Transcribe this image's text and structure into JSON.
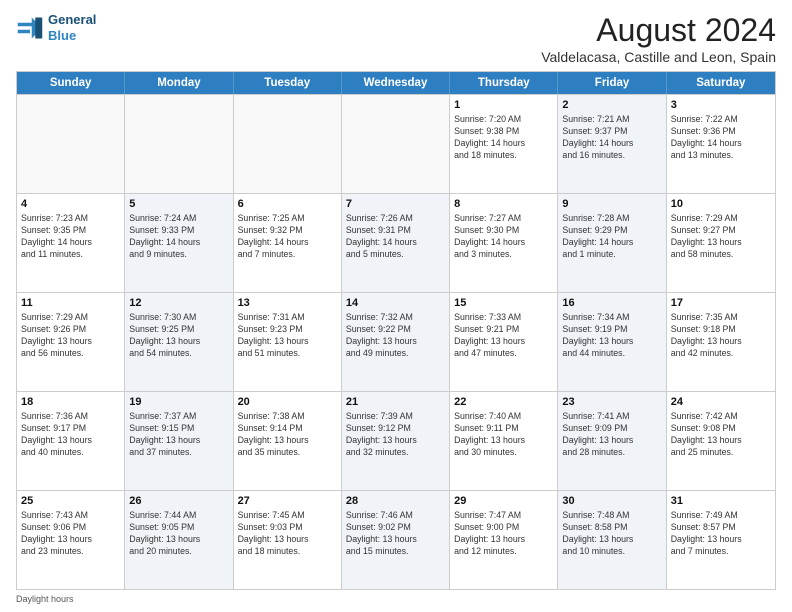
{
  "logo": {
    "line1": "General",
    "line2": "Blue"
  },
  "title": "August 2024",
  "subtitle": "Valdelacasa, Castille and Leon, Spain",
  "header_days": [
    "Sunday",
    "Monday",
    "Tuesday",
    "Wednesday",
    "Thursday",
    "Friday",
    "Saturday"
  ],
  "weeks": [
    [
      {
        "day": "",
        "info": "",
        "shaded": false,
        "empty": true
      },
      {
        "day": "",
        "info": "",
        "shaded": false,
        "empty": true
      },
      {
        "day": "",
        "info": "",
        "shaded": false,
        "empty": true
      },
      {
        "day": "",
        "info": "",
        "shaded": false,
        "empty": true
      },
      {
        "day": "1",
        "info": "Sunrise: 7:20 AM\nSunset: 9:38 PM\nDaylight: 14 hours\nand 18 minutes.",
        "shaded": false,
        "empty": false
      },
      {
        "day": "2",
        "info": "Sunrise: 7:21 AM\nSunset: 9:37 PM\nDaylight: 14 hours\nand 16 minutes.",
        "shaded": true,
        "empty": false
      },
      {
        "day": "3",
        "info": "Sunrise: 7:22 AM\nSunset: 9:36 PM\nDaylight: 14 hours\nand 13 minutes.",
        "shaded": false,
        "empty": false
      }
    ],
    [
      {
        "day": "4",
        "info": "Sunrise: 7:23 AM\nSunset: 9:35 PM\nDaylight: 14 hours\nand 11 minutes.",
        "shaded": false,
        "empty": false
      },
      {
        "day": "5",
        "info": "Sunrise: 7:24 AM\nSunset: 9:33 PM\nDaylight: 14 hours\nand 9 minutes.",
        "shaded": true,
        "empty": false
      },
      {
        "day": "6",
        "info": "Sunrise: 7:25 AM\nSunset: 9:32 PM\nDaylight: 14 hours\nand 7 minutes.",
        "shaded": false,
        "empty": false
      },
      {
        "day": "7",
        "info": "Sunrise: 7:26 AM\nSunset: 9:31 PM\nDaylight: 14 hours\nand 5 minutes.",
        "shaded": true,
        "empty": false
      },
      {
        "day": "8",
        "info": "Sunrise: 7:27 AM\nSunset: 9:30 PM\nDaylight: 14 hours\nand 3 minutes.",
        "shaded": false,
        "empty": false
      },
      {
        "day": "9",
        "info": "Sunrise: 7:28 AM\nSunset: 9:29 PM\nDaylight: 14 hours\nand 1 minute.",
        "shaded": true,
        "empty": false
      },
      {
        "day": "10",
        "info": "Sunrise: 7:29 AM\nSunset: 9:27 PM\nDaylight: 13 hours\nand 58 minutes.",
        "shaded": false,
        "empty": false
      }
    ],
    [
      {
        "day": "11",
        "info": "Sunrise: 7:29 AM\nSunset: 9:26 PM\nDaylight: 13 hours\nand 56 minutes.",
        "shaded": false,
        "empty": false
      },
      {
        "day": "12",
        "info": "Sunrise: 7:30 AM\nSunset: 9:25 PM\nDaylight: 13 hours\nand 54 minutes.",
        "shaded": true,
        "empty": false
      },
      {
        "day": "13",
        "info": "Sunrise: 7:31 AM\nSunset: 9:23 PM\nDaylight: 13 hours\nand 51 minutes.",
        "shaded": false,
        "empty": false
      },
      {
        "day": "14",
        "info": "Sunrise: 7:32 AM\nSunset: 9:22 PM\nDaylight: 13 hours\nand 49 minutes.",
        "shaded": true,
        "empty": false
      },
      {
        "day": "15",
        "info": "Sunrise: 7:33 AM\nSunset: 9:21 PM\nDaylight: 13 hours\nand 47 minutes.",
        "shaded": false,
        "empty": false
      },
      {
        "day": "16",
        "info": "Sunrise: 7:34 AM\nSunset: 9:19 PM\nDaylight: 13 hours\nand 44 minutes.",
        "shaded": true,
        "empty": false
      },
      {
        "day": "17",
        "info": "Sunrise: 7:35 AM\nSunset: 9:18 PM\nDaylight: 13 hours\nand 42 minutes.",
        "shaded": false,
        "empty": false
      }
    ],
    [
      {
        "day": "18",
        "info": "Sunrise: 7:36 AM\nSunset: 9:17 PM\nDaylight: 13 hours\nand 40 minutes.",
        "shaded": false,
        "empty": false
      },
      {
        "day": "19",
        "info": "Sunrise: 7:37 AM\nSunset: 9:15 PM\nDaylight: 13 hours\nand 37 minutes.",
        "shaded": true,
        "empty": false
      },
      {
        "day": "20",
        "info": "Sunrise: 7:38 AM\nSunset: 9:14 PM\nDaylight: 13 hours\nand 35 minutes.",
        "shaded": false,
        "empty": false
      },
      {
        "day": "21",
        "info": "Sunrise: 7:39 AM\nSunset: 9:12 PM\nDaylight: 13 hours\nand 32 minutes.",
        "shaded": true,
        "empty": false
      },
      {
        "day": "22",
        "info": "Sunrise: 7:40 AM\nSunset: 9:11 PM\nDaylight: 13 hours\nand 30 minutes.",
        "shaded": false,
        "empty": false
      },
      {
        "day": "23",
        "info": "Sunrise: 7:41 AM\nSunset: 9:09 PM\nDaylight: 13 hours\nand 28 minutes.",
        "shaded": true,
        "empty": false
      },
      {
        "day": "24",
        "info": "Sunrise: 7:42 AM\nSunset: 9:08 PM\nDaylight: 13 hours\nand 25 minutes.",
        "shaded": false,
        "empty": false
      }
    ],
    [
      {
        "day": "25",
        "info": "Sunrise: 7:43 AM\nSunset: 9:06 PM\nDaylight: 13 hours\nand 23 minutes.",
        "shaded": false,
        "empty": false
      },
      {
        "day": "26",
        "info": "Sunrise: 7:44 AM\nSunset: 9:05 PM\nDaylight: 13 hours\nand 20 minutes.",
        "shaded": true,
        "empty": false
      },
      {
        "day": "27",
        "info": "Sunrise: 7:45 AM\nSunset: 9:03 PM\nDaylight: 13 hours\nand 18 minutes.",
        "shaded": false,
        "empty": false
      },
      {
        "day": "28",
        "info": "Sunrise: 7:46 AM\nSunset: 9:02 PM\nDaylight: 13 hours\nand 15 minutes.",
        "shaded": true,
        "empty": false
      },
      {
        "day": "29",
        "info": "Sunrise: 7:47 AM\nSunset: 9:00 PM\nDaylight: 13 hours\nand 12 minutes.",
        "shaded": false,
        "empty": false
      },
      {
        "day": "30",
        "info": "Sunrise: 7:48 AM\nSunset: 8:58 PM\nDaylight: 13 hours\nand 10 minutes.",
        "shaded": true,
        "empty": false
      },
      {
        "day": "31",
        "info": "Sunrise: 7:49 AM\nSunset: 8:57 PM\nDaylight: 13 hours\nand 7 minutes.",
        "shaded": false,
        "empty": false
      }
    ]
  ],
  "footer": "Daylight hours"
}
